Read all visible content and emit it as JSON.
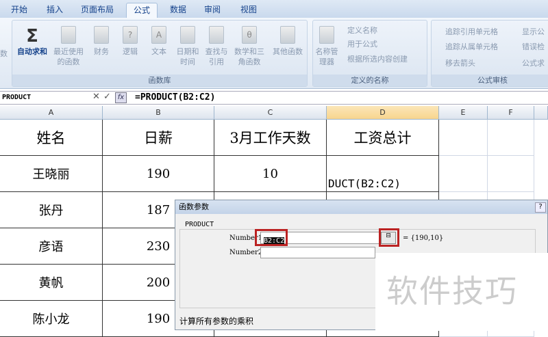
{
  "tabs": [
    "开始",
    "插入",
    "页面布局",
    "公式",
    "数据",
    "审阅",
    "视图"
  ],
  "ribbon": {
    "left_cut": "数",
    "function_library": {
      "label": "函数库",
      "buttons": [
        "自动求和",
        "最近使用的函数",
        "财务",
        "逻辑",
        "文本",
        "日期和时间",
        "查找与引用",
        "数学和三角函数",
        "其他函数"
      ]
    },
    "defined_names": {
      "label": "定义的名称",
      "manager": "名称管理器",
      "items": [
        "定义名称",
        "用于公式",
        "根据所选内容创建"
      ]
    },
    "formula_audit": {
      "label": "公式审核",
      "items": [
        "追踪引用单元格",
        "追踪从属单元格",
        "移去箭头",
        "显示公",
        "错误检",
        "公式求"
      ]
    }
  },
  "formula_bar": {
    "name_box": "PRODUCT",
    "formula": "=PRODUCT(B2:C2)",
    "fx": "fx"
  },
  "columns": [
    "A",
    "B",
    "C",
    "D",
    "E",
    "F"
  ],
  "table": {
    "headers": [
      "姓名",
      "日薪",
      "3月工作天数",
      "工资总计"
    ],
    "rows": [
      [
        "王晓丽",
        "190",
        "10",
        "DUCT(B2:C2)"
      ],
      [
        "张丹",
        "187",
        "",
        ""
      ],
      [
        "彦语",
        "230",
        "",
        ""
      ],
      [
        "黄帆",
        "200",
        "",
        ""
      ],
      [
        "陈小龙",
        "190",
        "",
        ""
      ]
    ]
  },
  "dialog": {
    "title": "函数参数",
    "help": "?",
    "function": "PRODUCT",
    "arg1_label": "Number1",
    "arg1_value": "B2:C2",
    "arg1_result": "= {190,10}",
    "arg2_label": "Number2",
    "arg2_value": "",
    "description": "计算所有参数的乘积"
  },
  "watermark": "软件技巧"
}
